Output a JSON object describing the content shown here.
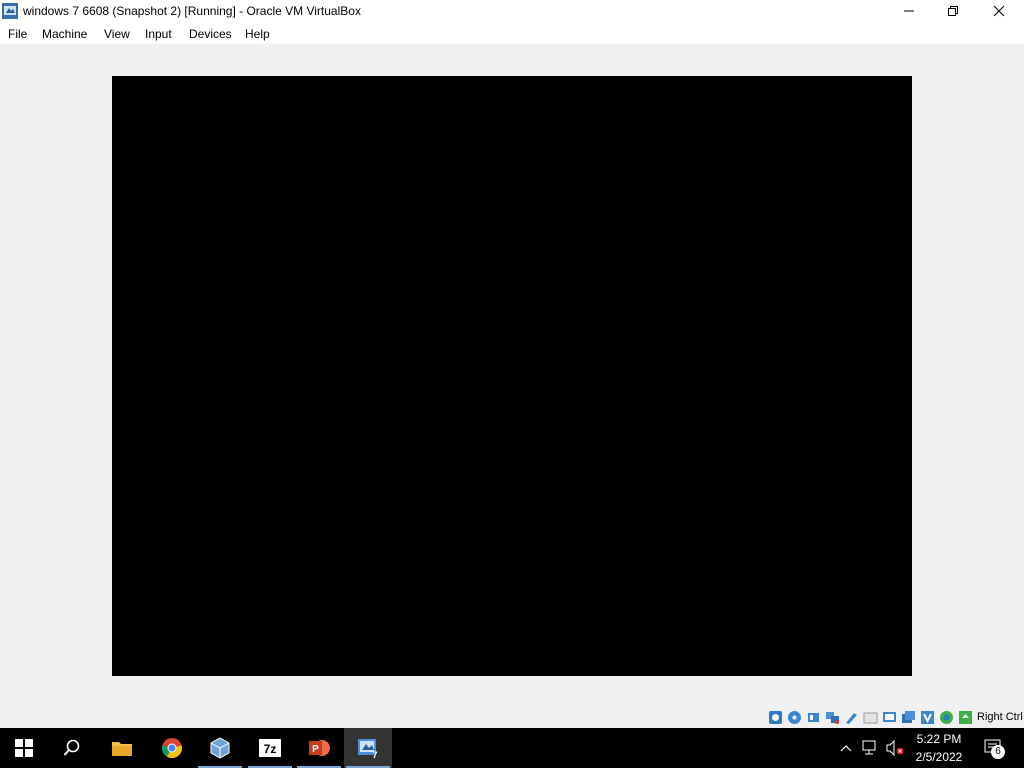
{
  "window": {
    "title": "windows 7 6608 (Snapshot 2) [Running] - Oracle VM VirtualBox",
    "minimize_icon": "minimize-icon",
    "maximize_icon": "restore-icon",
    "close_icon": "close-icon"
  },
  "menu": {
    "items": [
      {
        "label": "File"
      },
      {
        "label": "Machine"
      },
      {
        "label": "View"
      },
      {
        "label": "Input"
      },
      {
        "label": "Devices"
      },
      {
        "label": "Help"
      }
    ]
  },
  "vm_screen": {
    "color": "#000000"
  },
  "statusbar": {
    "icons": [
      "hard-disk-icon",
      "optical-drive-icon",
      "audio-icon",
      "network-icon",
      "usb-icon",
      "shared-folders-icon",
      "display-icon",
      "recording-icon",
      "vt-x-icon",
      "mouse-integration-icon",
      "keyboard-icon"
    ],
    "host_key": "Right Ctrl"
  },
  "taskbar": {
    "apps": [
      "start-icon",
      "search-icon",
      "file-explorer-icon",
      "chrome-icon",
      "virtualbox-icon",
      "7zip-icon",
      "powerpoint-icon",
      "virtualbox-vm-icon"
    ],
    "time": "5:22 PM",
    "date": "2/5/2022",
    "notification_count": "6"
  }
}
